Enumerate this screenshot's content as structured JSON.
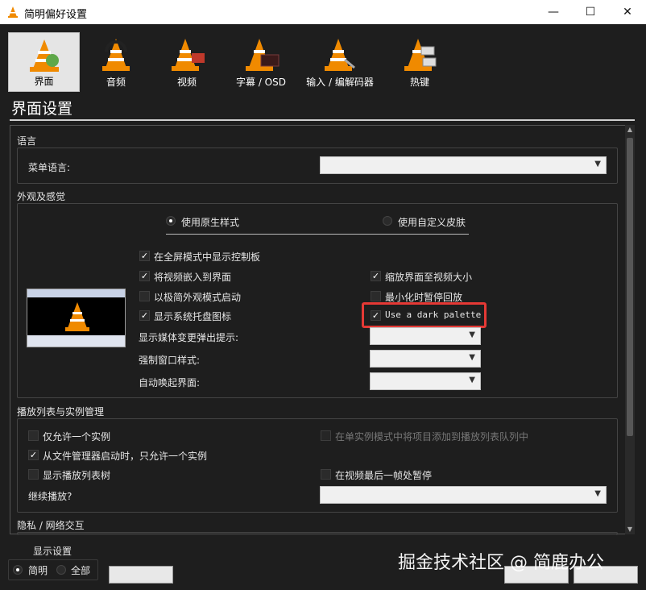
{
  "window": {
    "title": "简明偏好设置"
  },
  "toolbar": {
    "items": [
      {
        "label": "界面",
        "icon": "interface-cone-icon"
      },
      {
        "label": "音频",
        "icon": "audio-cone-icon"
      },
      {
        "label": "视频",
        "icon": "video-cone-icon"
      },
      {
        "label": "字幕 / OSD",
        "icon": "subtitle-cone-icon"
      },
      {
        "label": "输入 / 编解码器",
        "icon": "codec-cone-icon"
      },
      {
        "label": "热键",
        "icon": "hotkey-cone-icon"
      }
    ]
  },
  "section_title": "界面设置",
  "language": {
    "group": "语言",
    "menu_label": "菜单语言:"
  },
  "appearance": {
    "group": "外观及感觉",
    "native_style": "使用原生样式",
    "custom_skin": "使用自定义皮肤",
    "options_left": [
      {
        "label": "在全屏模式中显示控制板",
        "checked": true
      },
      {
        "label": "将视频嵌入到界面",
        "checked": true
      },
      {
        "label": "以极简外观模式启动",
        "checked": false
      },
      {
        "label": "显示系统托盘图标",
        "checked": true
      }
    ],
    "options_right": [
      {
        "label": "缩放界面至视频大小",
        "checked": true
      },
      {
        "label": "最小化时暂停回放",
        "checked": false
      },
      {
        "label": "Use a dark palette",
        "checked": true
      }
    ],
    "popup_label": "显示媒体变更弹出提示:",
    "force_window_label": "强制窗口样式:",
    "auto_raise_label": "自动唤起界面:"
  },
  "playlist": {
    "group": "播放列表与实例管理",
    "single_instance": "仅允许一个实例",
    "enqueue_in_single": "在单实例模式中将项目添加到播放列表队列中",
    "file_manager_single": "从文件管理器启动时，只允许一个实例",
    "show_tree": "显示播放列表树",
    "pause_last_frame": "在视频最后一帧处暂停",
    "resume_label": "继续播放?"
  },
  "privacy": {
    "group": "隐私 / 网络交互"
  },
  "footer": {
    "show_settings": "显示设置",
    "simple": "简明",
    "all": "全部"
  },
  "watermark": "掘金技术社区 @ 简鹿办公"
}
